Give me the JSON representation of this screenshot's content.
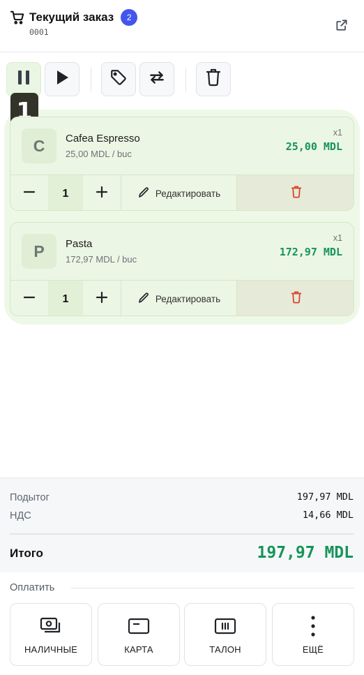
{
  "colors": {
    "accent": "#4455ee",
    "price_green": "#16945a",
    "delete_red": "#d9452b",
    "selection_green": "#eef8e6",
    "step_badge": "#33332a"
  },
  "header": {
    "title": "Текущий заказ",
    "item_count": "2",
    "order_number": "0001",
    "icon": "cart-icon",
    "open_external_icon": "external-link-icon"
  },
  "toolbar": {
    "buttons": [
      {
        "name": "pause",
        "icon": "pause-icon",
        "active": true
      },
      {
        "name": "resume",
        "icon": "play-icon",
        "active": false
      },
      {
        "name": "discount",
        "icon": "tag-icon",
        "active": false
      },
      {
        "name": "transfer",
        "icon": "swap-icon",
        "active": false
      },
      {
        "name": "clear",
        "icon": "trash-icon",
        "active": false
      }
    ],
    "step_badge": "1"
  },
  "items": [
    {
      "initial": "C",
      "name": "Cafea Espresso",
      "unit_price": "25,00 MDL / buc",
      "qty_label": "x1",
      "total": "25,00 MDL",
      "quantity": "1",
      "edit_label": "Редактировать"
    },
    {
      "initial": "P",
      "name": "Pasta",
      "unit_price": "172,97 MDL / buc",
      "qty_label": "x1",
      "total": "172,97 MDL",
      "quantity": "1",
      "edit_label": "Редактировать"
    }
  ],
  "totals": {
    "subtotal_label": "Подытог",
    "subtotal_value": "197,97 MDL",
    "vat_label": "НДС",
    "vat_value": "14,66 MDL",
    "grand_label": "Итого",
    "grand_value": "197,97 MDL"
  },
  "payment": {
    "section_label": "Оплатить",
    "methods": [
      {
        "label": "НАЛИЧНЫЕ",
        "icon": "cash-icon"
      },
      {
        "label": "КАРТА",
        "icon": "card-icon"
      },
      {
        "label": "ТАЛОН",
        "icon": "voucher-icon"
      },
      {
        "label": "ЕЩЁ",
        "icon": "more-vertical-icon"
      }
    ]
  }
}
